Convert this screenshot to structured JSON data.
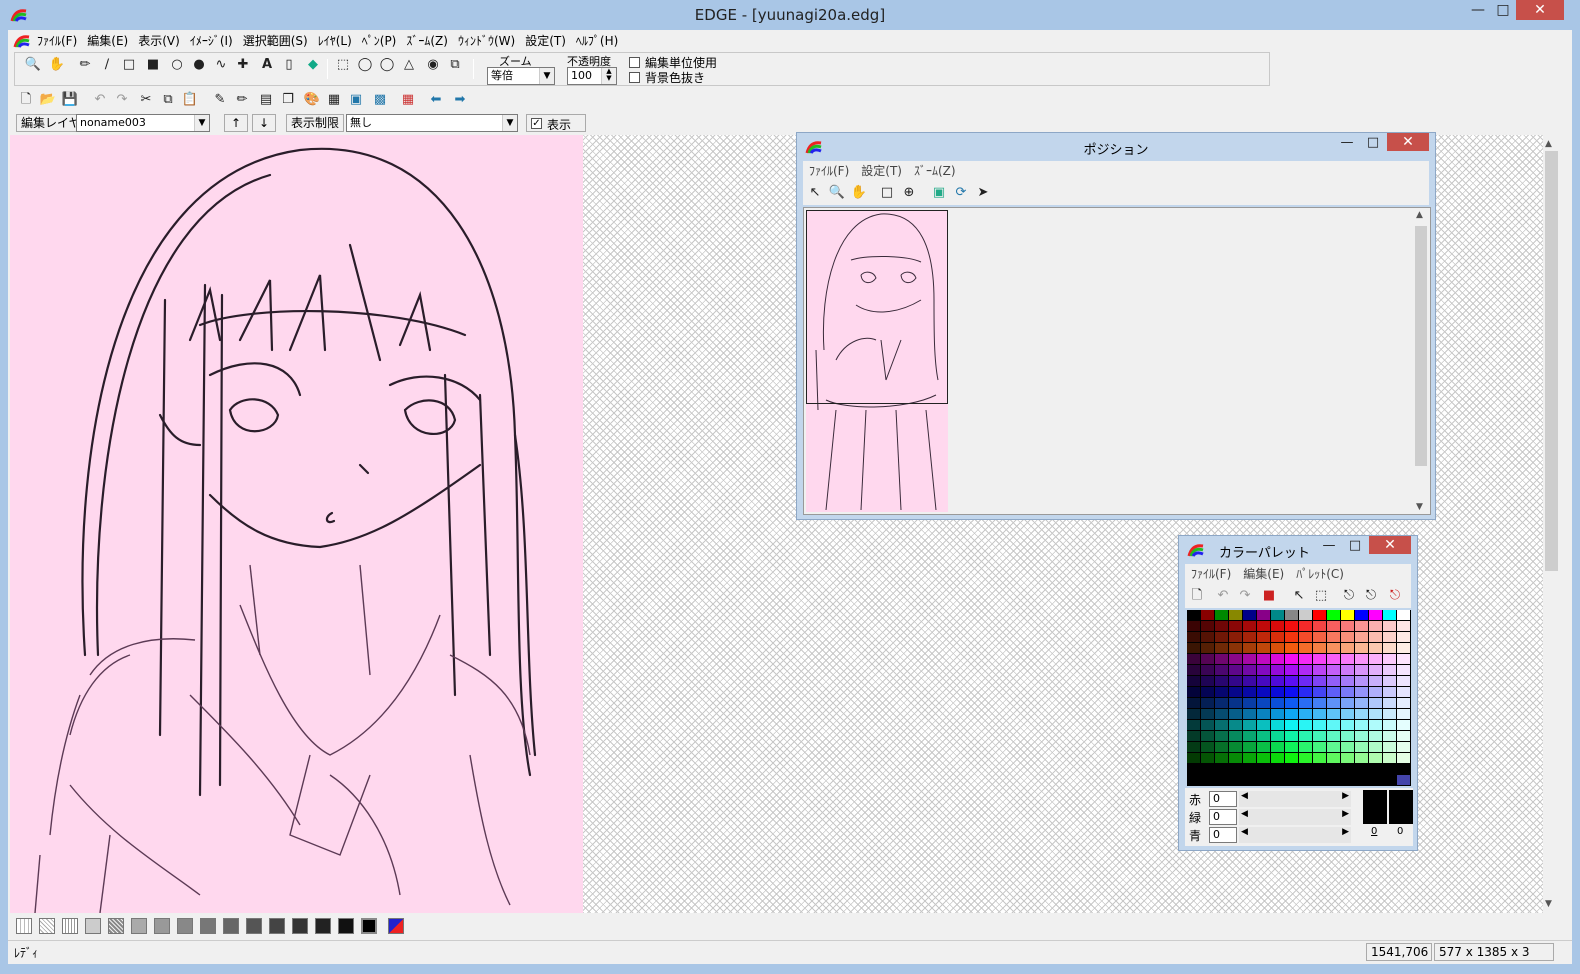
{
  "title": "EDGE - [yuunagi20a.edg]",
  "menu": [
    "ﾌｧｲﾙ(F)",
    "編集(E)",
    "表示(V)",
    "ｲﾒｰｼﾞ(I)",
    "選択範囲(S)",
    "ﾚｲﾔ(L)",
    "ﾍﾟﾝ(P)",
    "ｽﾞｰﾑ(Z)",
    "ｳｨﾝﾄﾞｳ(W)",
    "設定(T)",
    "ﾍﾙﾌﾟ(H)"
  ],
  "toolbar": {
    "zoom_label": "ズーム",
    "zoom_value": "等倍",
    "opacity_label": "不透明度",
    "opacity_value": "100",
    "edit_unit_label": "編集単位使用",
    "bg_transparent_label": "背景色抜き"
  },
  "layerbar": {
    "layer_label": "編集レイヤ",
    "layer_value": "noname003",
    "up": "↑",
    "down": "↓",
    "limit_label": "表示制限",
    "limit_value": "無し",
    "show_label": "表示"
  },
  "status": {
    "text": "ﾚﾃﾞｨ",
    "coords": "1541,706",
    "size": "577 x 1385 x 3"
  },
  "position_window": {
    "title": "ポジション",
    "menu": [
      "ﾌｧｲﾙ(F)",
      "設定(T)",
      "ｽﾞｰﾑ(Z)"
    ]
  },
  "palette_window": {
    "title": "カラーパレット",
    "menu": [
      "ﾌｧｲﾙ(F)",
      "編集(E)",
      "ﾊﾟﾚｯﾄ(C)"
    ],
    "red_label": "赤",
    "green_label": "緑",
    "blue_label": "青",
    "red": "0",
    "green": "0",
    "blue": "0",
    "fg_index": "0",
    "bg_index": "0"
  },
  "colors": {
    "canvas": "#ffd8ee",
    "title_bg": "#a9c6e6",
    "close": "#c7504a"
  }
}
